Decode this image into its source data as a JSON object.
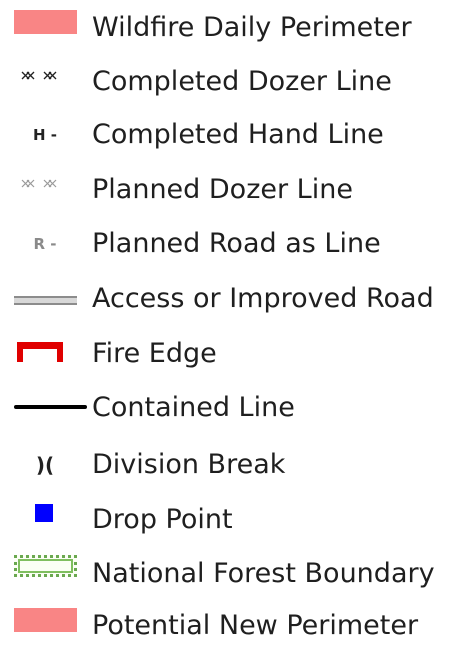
{
  "legend": {
    "items": [
      {
        "symbol": "pink-fill-swatch",
        "label": "Wildfire Daily Perimeter",
        "color": "#f98585"
      },
      {
        "symbol": "black-x-line",
        "label": "Completed Dozer Line"
      },
      {
        "symbol": "hand-line",
        "glyph": "H -",
        "label": "Completed Hand Line"
      },
      {
        "symbol": "gray-x-line",
        "label": "Planned Dozer Line"
      },
      {
        "symbol": "road-line",
        "glyph": "R -",
        "label": "Planned Road as Line"
      },
      {
        "symbol": "double-gray-line",
        "label": "Access or Improved Road"
      },
      {
        "symbol": "red-bracket",
        "label": "Fire Edge",
        "color": "#e00000"
      },
      {
        "symbol": "black-line",
        "label": "Contained Line"
      },
      {
        "symbol": "division-break-glyph",
        "glyph": ")(",
        "label": "Division Break"
      },
      {
        "symbol": "blue-square",
        "label": "Drop Point",
        "color": "#0000ff"
      },
      {
        "symbol": "green-outline-box",
        "label": "National Forest Boundary",
        "color": "#6aa84f"
      },
      {
        "symbol": "pink-fill-swatch",
        "label": "Potential New Perimeter",
        "color": "#f98585"
      }
    ]
  }
}
